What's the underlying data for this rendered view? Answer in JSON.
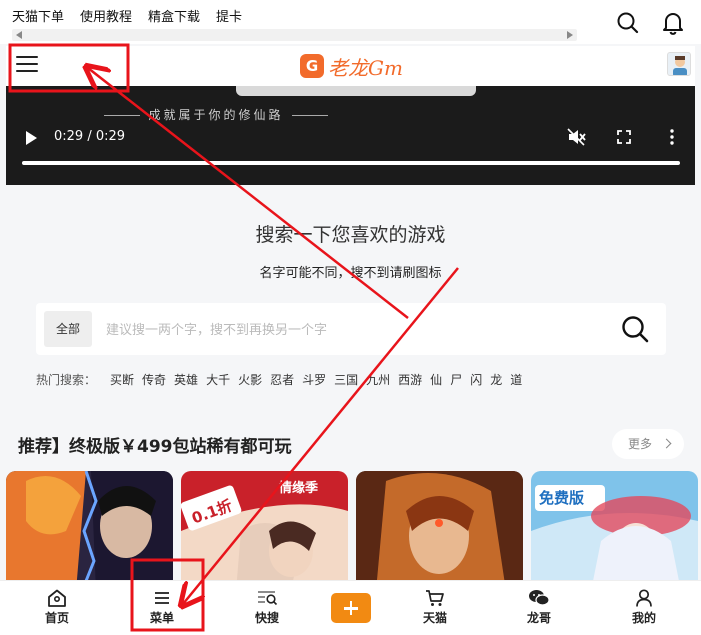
{
  "top_links": [
    "天猫下单",
    "使用教程",
    "精盒下载",
    "提卡"
  ],
  "header": {
    "logo_text": "老龙Gm",
    "logo_mark": "G"
  },
  "video": {
    "banner_text": "成就属于你的修仙路",
    "time": "0:29 / 0:29",
    "progress": 1.0
  },
  "search": {
    "title": "搜索一下您喜欢的游戏",
    "subtitle": "名字可能不同，搜不到请刷图标",
    "scope": "全部",
    "placeholder": "建议搜一两个字，搜不到再换另一个字",
    "hot_label": "热门搜索：",
    "hot_terms": [
      "买断",
      "传奇",
      "英雄",
      "大千",
      "火影",
      "忍者",
      "斗罗",
      "三国",
      "九州",
      "西游",
      "仙",
      "尸",
      "闪",
      "龙",
      "道"
    ]
  },
  "recommend": {
    "title": "推荐】终极版￥499包站稀有都可玩",
    "more": "更多",
    "games": [
      {
        "badge": ""
      },
      {
        "badge": "0.1折",
        "tag": "情缘季"
      },
      {
        "badge": ""
      },
      {
        "badge": "免费版"
      }
    ]
  },
  "bottom_nav": {
    "home": "首页",
    "menu": "菜单",
    "quick_search": "快搜",
    "tmall": "天猫",
    "longge": "龙哥",
    "mine": "我的"
  },
  "colors": {
    "brand": "#f26b2b",
    "plus_button": "#f28a12",
    "annotation": "#e8141b"
  }
}
